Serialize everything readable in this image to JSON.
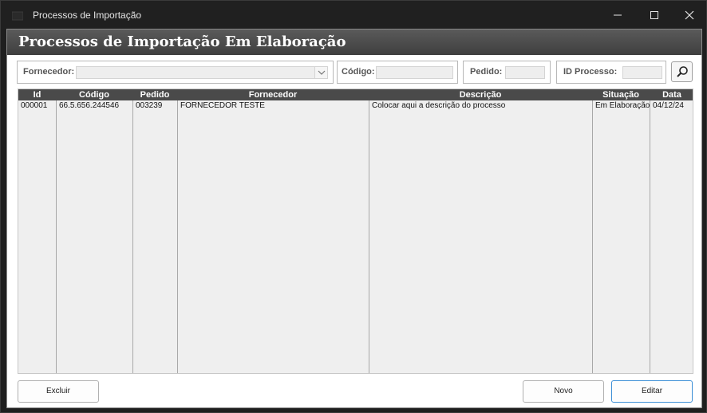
{
  "window": {
    "title": "Processos de Importação"
  },
  "banner": {
    "title": "Processos de Importação Em Elaboração"
  },
  "filters": {
    "fornecedor_label": "Fornecedor:",
    "fornecedor_value": "",
    "codigo_label": "Código:",
    "codigo_value": "",
    "pedido_label": "Pedido:",
    "pedido_value": "",
    "id_processo_label": "ID Processo:",
    "id_processo_value": ""
  },
  "grid": {
    "columns": [
      "Id",
      "Código",
      "Pedido",
      "Fornecedor",
      "Descrição",
      "Situação",
      "Data"
    ],
    "rows": [
      [
        "000001",
        "66.5.656.244546",
        "003239",
        "FORNECEDOR TESTE",
        "Colocar aqui a descrição do processo",
        "Em Elaboração",
        "04/12/24"
      ]
    ]
  },
  "buttons": {
    "excluir": "Excluir",
    "novo": "Novo",
    "editar": "Editar"
  },
  "colors": {
    "banner": "#4a4a4a",
    "grid_header": "#4a4a4a",
    "grid_body": "#efefef",
    "primary_border": "#3c8fd6"
  }
}
